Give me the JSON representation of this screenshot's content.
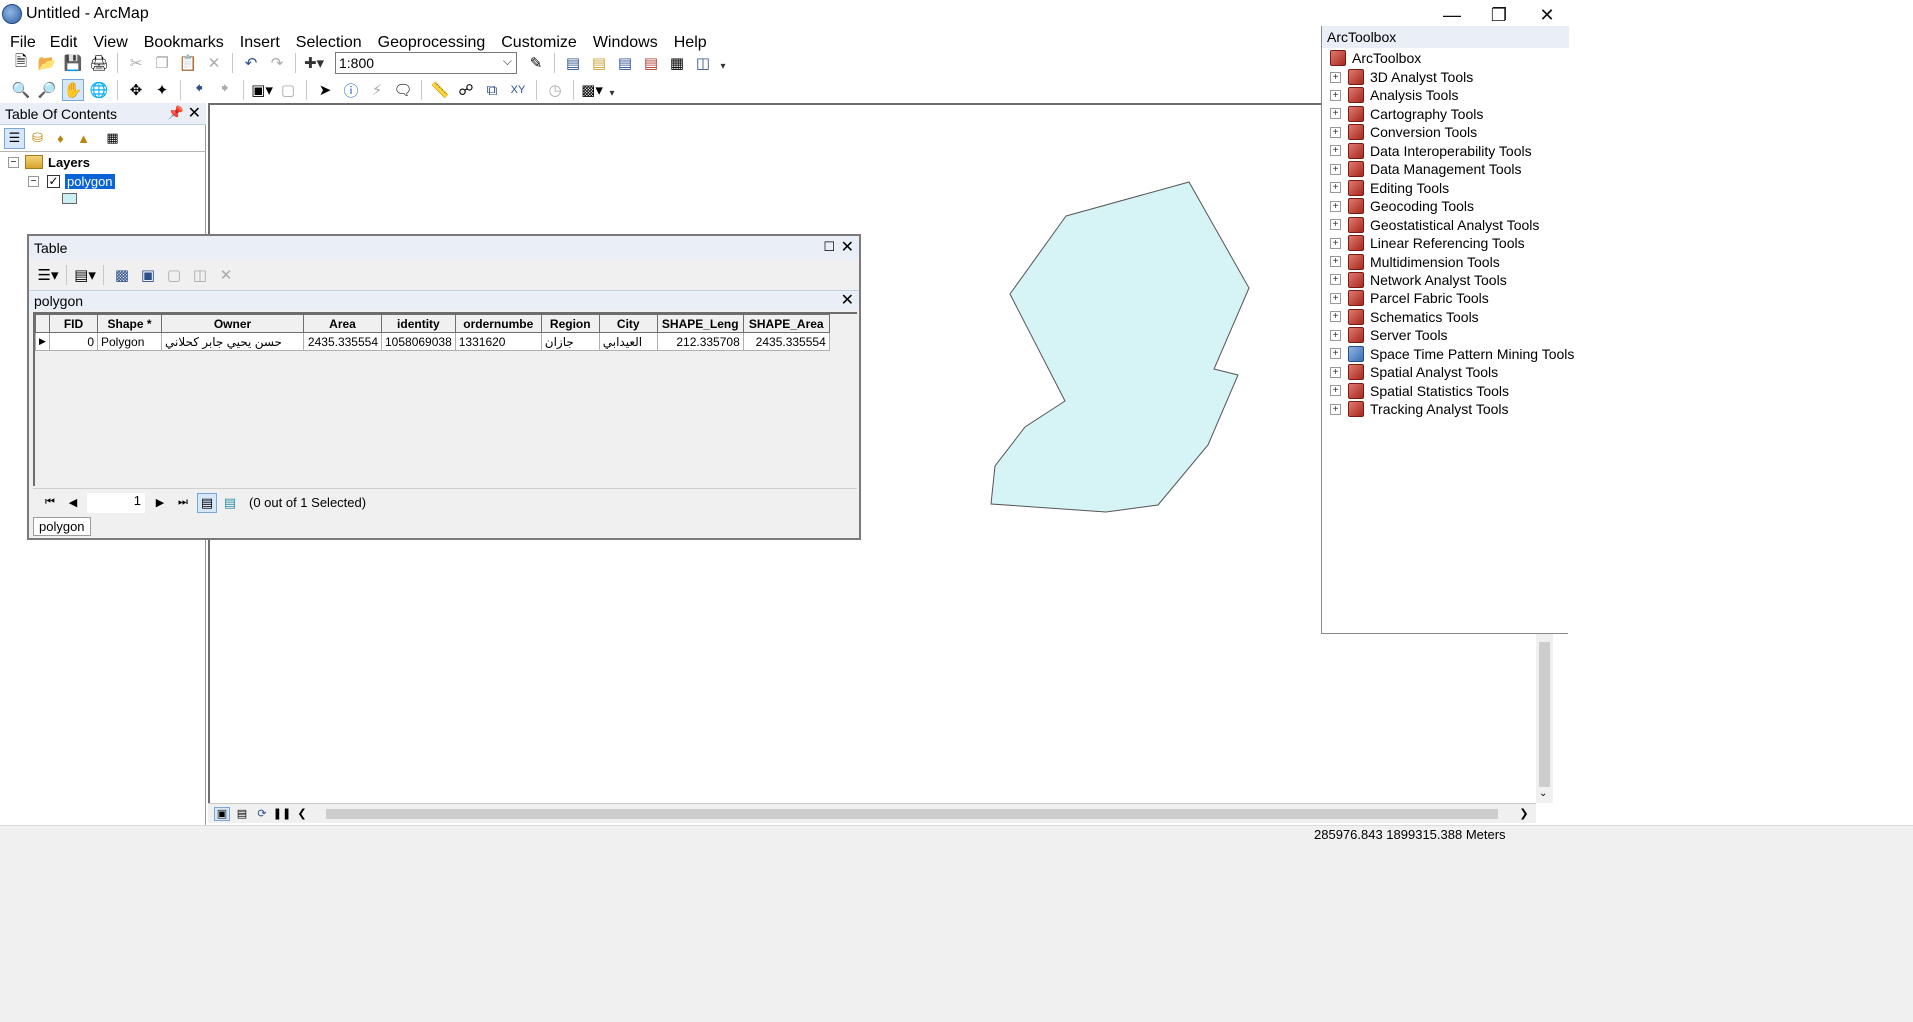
{
  "window": {
    "title": "Untitled - ArcMap",
    "controls": [
      "minimize",
      "restore",
      "close"
    ]
  },
  "menubar": [
    "File",
    "Edit",
    "View",
    "Bookmarks",
    "Insert",
    "Selection",
    "Geoprocessing",
    "Customize",
    "Windows",
    "Help"
  ],
  "standard_toolbar": {
    "scale": "1:800"
  },
  "toc": {
    "title": "Table Of Contents",
    "root_label": "Layers",
    "layer_label": "polygon",
    "layer_checked": true,
    "symbol_fill": "#cdeff3"
  },
  "toolbox": {
    "title": "ArcToolbox",
    "root_label": "ArcToolbox",
    "items": [
      "3D Analyst Tools",
      "Analysis Tools",
      "Cartography Tools",
      "Conversion Tools",
      "Data Interoperability Tools",
      "Data Management Tools",
      "Editing Tools",
      "Geocoding Tools",
      "Geostatistical Analyst Tools",
      "Linear Referencing Tools",
      "Multidimension Tools",
      "Network Analyst Tools",
      "Parcel Fabric Tools",
      "Schematics Tools",
      "Server Tools",
      "Space Time Pattern Mining Tools",
      "Spatial Analyst Tools",
      "Spatial Statistics Tools",
      "Tracking Analyst Tools"
    ]
  },
  "table": {
    "title": "Table",
    "tab_name": "polygon",
    "columns": [
      "FID",
      "Shape *",
      "Owner",
      "Area",
      "identity",
      "ordernumbe",
      "Region",
      "City",
      "SHAPE_Leng",
      "SHAPE_Area"
    ],
    "rows": [
      [
        "0",
        "Polygon",
        "حسن يحيي جابر كحلاني",
        "2435.335554",
        "1058069038",
        "1331620",
        "جازان",
        "العيدابي",
        "212.335708",
        "2435.335554"
      ]
    ],
    "current_record": "1",
    "selection_status": "(0 out of 1 Selected)",
    "bottom_tab": "polygon"
  },
  "map": {
    "polygon_fill": "#d6f3f6",
    "polygon_stroke": "#555555"
  },
  "status": {
    "coordinates": "285976.843  1899315.388 Meters"
  }
}
